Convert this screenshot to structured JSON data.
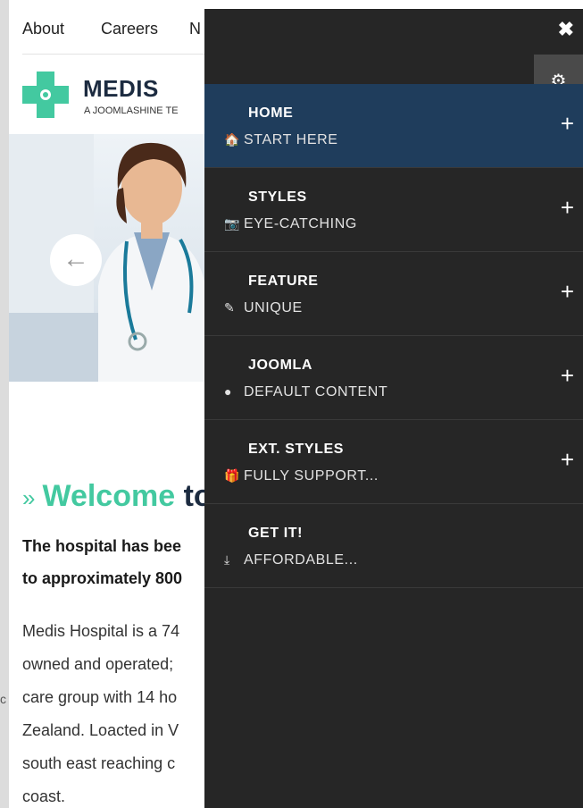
{
  "topnav": {
    "items": [
      "About",
      "Careers",
      "N"
    ]
  },
  "brand": {
    "name": "MEDIS",
    "tagline": "A JOOMLASHINE TE"
  },
  "hero": {
    "arrow": "←"
  },
  "welcome": {
    "raquo": "»",
    "word": "Welcome",
    "to": " to"
  },
  "lead": [
    "The hospital has bee",
    "to approximately 800"
  ],
  "body": [
    "Medis Hospital is a 74",
    "owned and operated;",
    "care group with 14 ho",
    "Zealand. Loacted in V",
    "south east reaching c",
    "coast."
  ],
  "stray_char": "c",
  "offcanvas": {
    "close_icon": "✖",
    "settings_icon": "⚙",
    "menu": [
      {
        "title": "HOME",
        "subtitle": "START HERE",
        "icon": "home-icon",
        "glyph": "🏠",
        "active": true
      },
      {
        "title": "STYLES",
        "subtitle": "EYE-CATCHING",
        "icon": "camera-icon",
        "glyph": "📷",
        "active": false
      },
      {
        "title": "FEATURE",
        "subtitle": "UNIQUE",
        "icon": "magic-wand-icon",
        "glyph": "✎",
        "active": false
      },
      {
        "title": "JOOMLA",
        "subtitle": "DEFAULT CONTENT",
        "icon": "globe-icon",
        "glyph": "●",
        "active": false
      },
      {
        "title": "EXT. STYLES",
        "subtitle": "FULLY SUPPORT...",
        "icon": "gift-icon",
        "glyph": "🎁",
        "active": false
      },
      {
        "title": "GET IT!",
        "subtitle": "AFFORDABLE...",
        "icon": "download-icon",
        "glyph": "⤓",
        "active": false
      }
    ],
    "expand_glyph": "+"
  },
  "colors": {
    "accent_green": "#43c9a0",
    "menu_bg": "#262626",
    "menu_active_bg": "#1f3d5c"
  }
}
